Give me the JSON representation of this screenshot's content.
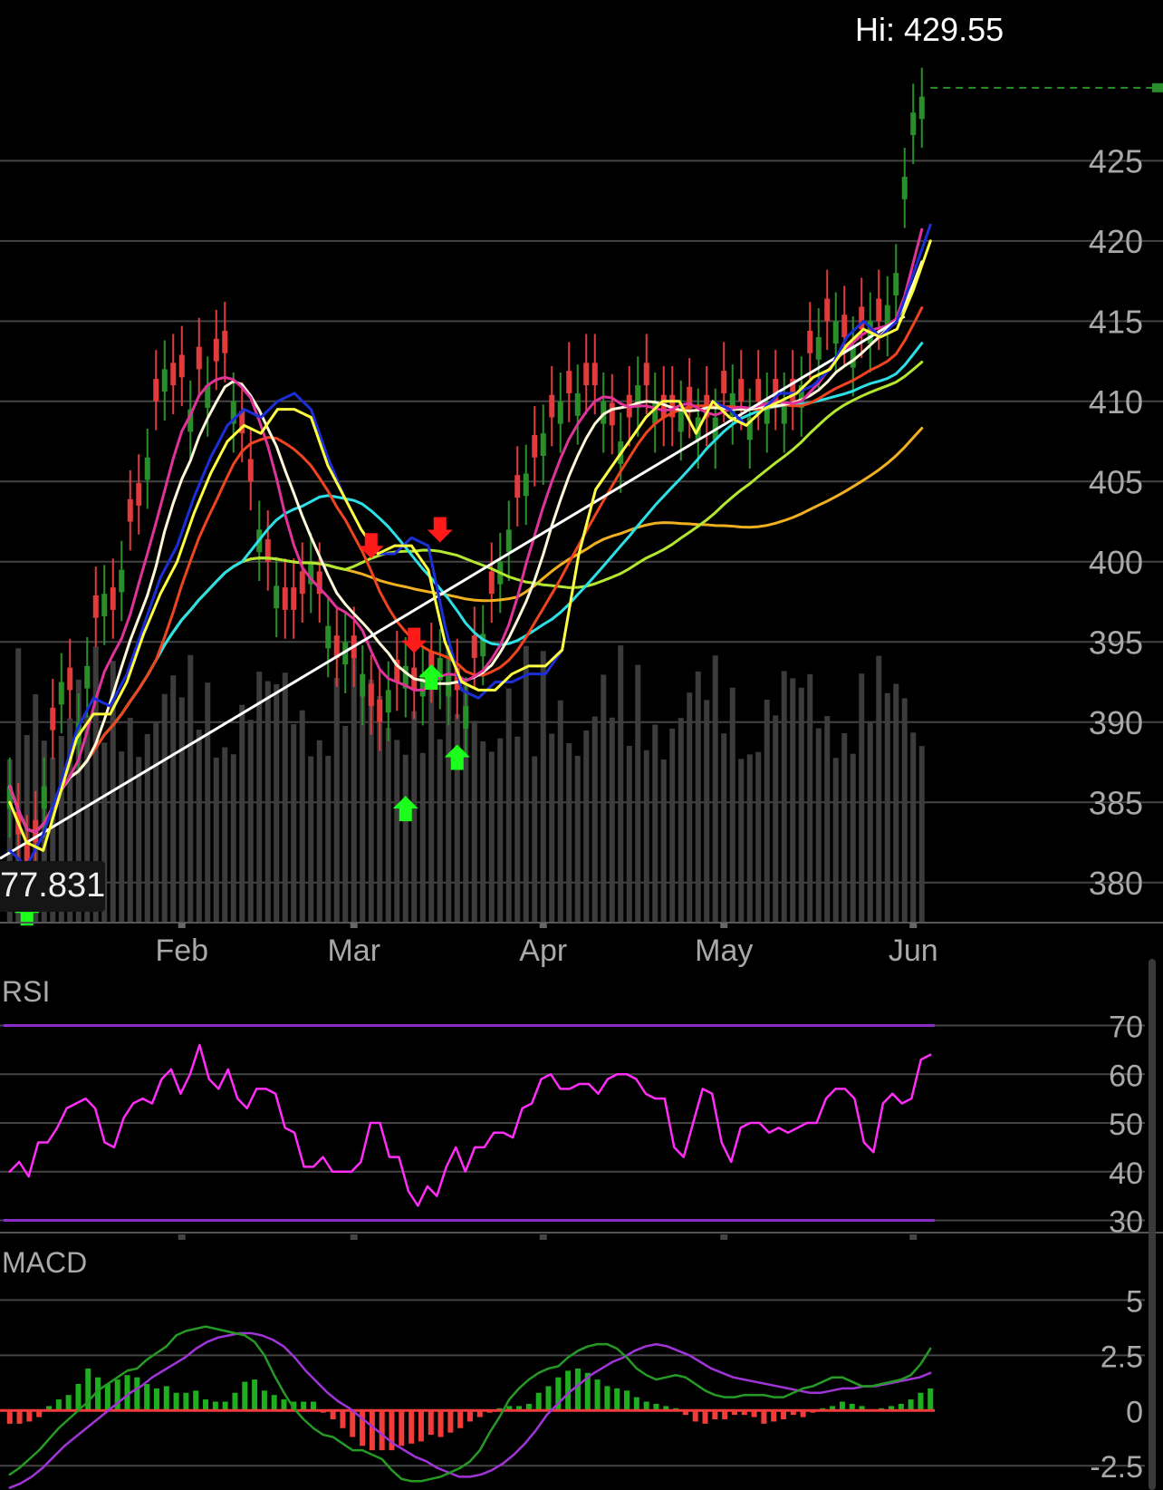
{
  "header": {
    "hi_prefix": "Hi:",
    "hi_value": "429.55",
    "low_value": "77.831"
  },
  "colors": {
    "up_candle": "#2a8f2a",
    "down_candle": "#e23b3b",
    "volume": "#3c3c3c",
    "grid": "#444444",
    "axis_text": "#a8a8a8",
    "ma_blue": "#1b2fd8",
    "ma_yellow": "#ffff40",
    "ma_magenta": "#e0339a",
    "ma_cream": "#fff8d8",
    "ma_orange": "#f0441e",
    "trend_white": "#ffffff",
    "ma_cyan": "#2ce0e8",
    "ma_lime": "#b4e830",
    "ma_gold": "#f0b020",
    "rsi": "#ff2df6",
    "rsi_bands": "#8a2bc8",
    "macd": "#259a25",
    "macd_signal": "#9f35d6",
    "hist_up": "#1fae1f",
    "hist_down": "#f23b3b",
    "buy_arrow": "#1cff1c",
    "sell_arrow": "#ff1a1a"
  },
  "chart_data": [
    {
      "type": "candlestick",
      "title": "",
      "x_labels": [
        "Feb",
        "Mar",
        "Apr",
        "May",
        "Jun"
      ],
      "x_label_days": [
        20,
        40,
        62,
        83,
        105
      ],
      "y_ticks": [
        425,
        420,
        415,
        410,
        405,
        400,
        395,
        390,
        385,
        380
      ],
      "ylim": [
        377.5,
        430.5
      ],
      "hi_value": 429.55,
      "day_count": 108,
      "close": [
        386,
        383,
        381,
        382.5,
        386,
        389.5,
        392.5,
        392,
        390,
        393.5,
        396.5,
        398,
        397,
        399.5,
        402.5,
        403.5,
        406.5,
        410,
        412,
        411,
        411.5,
        409.5,
        412,
        411,
        412.5,
        413,
        410,
        408,
        405,
        402,
        400,
        398.5,
        397,
        397,
        398,
        400,
        398,
        396,
        394,
        395,
        394,
        393,
        391,
        390,
        392,
        392.5,
        393.5,
        392,
        393,
        393,
        394,
        393,
        392,
        391,
        394,
        395.5,
        398,
        400,
        402,
        404,
        405.5,
        406.5,
        408,
        409,
        410,
        410.5,
        410.5,
        411,
        411,
        410,
        408.5,
        407.5,
        409,
        411,
        411,
        410,
        409,
        409,
        409.5,
        409.5,
        409,
        409,
        409,
        410.5,
        410.5,
        410,
        409,
        410,
        410,
        410,
        410,
        410,
        411,
        413,
        414,
        415,
        415,
        414,
        413.5,
        414.5,
        415,
        415,
        416,
        418,
        424,
        428,
        429
      ],
      "bull_days": [
        0,
        4,
        6,
        8,
        9,
        11,
        13,
        16,
        18,
        21,
        23,
        26,
        29,
        31,
        35,
        37,
        39,
        41,
        44,
        46,
        48,
        50,
        51,
        53,
        55,
        57,
        58,
        60,
        62,
        64,
        66,
        69,
        71,
        73,
        75,
        78,
        80,
        82,
        84,
        86,
        88,
        90,
        92,
        94,
        96,
        98,
        100,
        102,
        103,
        104,
        105,
        106,
        107
      ],
      "moving_averages": [
        {
          "color_key": "ma_blue",
          "values": [
            382,
            381,
            383,
            386,
            389.5,
            391.5,
            391,
            393,
            396,
            399,
            401,
            404,
            406.5,
            408.5,
            409.5,
            409,
            410,
            410.5,
            409.5,
            406.5,
            404,
            402,
            400.5,
            400.5,
            401.5,
            401,
            396,
            392,
            391.5,
            392.5,
            392.5,
            393,
            393,
            394.5,
            400.5,
            404.5,
            406,
            407.5,
            409,
            410,
            410,
            408,
            410,
            409.5,
            408.5,
            409.5,
            410.5,
            410.5,
            411,
            412,
            414,
            415,
            414,
            415,
            418,
            421
          ]
        },
        {
          "color_key": "ma_yellow",
          "values": [
            385,
            382.5,
            382,
            385.5,
            389,
            390.5,
            390.5,
            392.5,
            395.5,
            398,
            400,
            403,
            405.5,
            407.5,
            408.5,
            408,
            409.5,
            409.5,
            409,
            406,
            404,
            402,
            400.5,
            401,
            401,
            399.5,
            395,
            392.5,
            392,
            392,
            393,
            393.5,
            393.5,
            394.5,
            400.5,
            404.5,
            406,
            407.5,
            409,
            410,
            410,
            408,
            410,
            409,
            408.5,
            409.5,
            410,
            410.5,
            411.5,
            412,
            413.5,
            414.5,
            414,
            414.5,
            417,
            420
          ]
        }
      ]
    },
    {
      "type": "line",
      "title": "RSI",
      "y_ticks": [
        70,
        60,
        50,
        40,
        30
      ],
      "ylim": [
        26,
        74
      ],
      "overbought": 70,
      "oversold": 30,
      "values": [
        40,
        42,
        39,
        46,
        46,
        49,
        53,
        54,
        55,
        53,
        46,
        45,
        51,
        54,
        55,
        54,
        59,
        61,
        56,
        60,
        66,
        59,
        57,
        61,
        55,
        53,
        57,
        57,
        56,
        49,
        48,
        41,
        41,
        43,
        40,
        40,
        40,
        42,
        50,
        50,
        43,
        43,
        36,
        33,
        37,
        35,
        41,
        45,
        40,
        45,
        45,
        48,
        48,
        47,
        53,
        54,
        59,
        60,
        57,
        57,
        58,
        58,
        56,
        59,
        60,
        60,
        59,
        56,
        55,
        55,
        45,
        43,
        50,
        57,
        56,
        46,
        42,
        49,
        50,
        50,
        48,
        49,
        48,
        49,
        50,
        50,
        55,
        57,
        57,
        55,
        46,
        44,
        54,
        56,
        54,
        55,
        63,
        64
      ]
    },
    {
      "type": "line",
      "title": "MACD",
      "y_ticks": [
        "5",
        "2.5",
        "0",
        "-2.5"
      ],
      "ylim": [
        -3.6,
        6
      ],
      "macd": [
        -2.9,
        -2.6,
        -2.2,
        -1.8,
        -1.3,
        -0.8,
        -0.4,
        0.0,
        0.4,
        0.9,
        1.2,
        1.5,
        1.8,
        1.9,
        2.3,
        2.6,
        2.9,
        3.4,
        3.6,
        3.7,
        3.8,
        3.7,
        3.6,
        3.5,
        3.4,
        3.1,
        2.5,
        1.6,
        0.8,
        0.1,
        -0.4,
        -0.8,
        -1.1,
        -1.2,
        -1.5,
        -1.8,
        -1.8,
        -2.0,
        -2.2,
        -2.7,
        -3.1,
        -3.2,
        -3.2,
        -3.1,
        -3.0,
        -2.8,
        -2.6,
        -2.3,
        -1.8,
        -1.0,
        -0.3,
        0.5,
        1.0,
        1.4,
        1.7,
        1.9,
        2.0,
        2.4,
        2.7,
        2.9,
        3.0,
        3.0,
        2.8,
        2.4,
        1.9,
        1.6,
        1.4,
        1.5,
        1.6,
        1.5,
        1.2,
        0.9,
        0.7,
        0.6,
        0.6,
        0.7,
        0.7,
        0.7,
        0.6,
        0.6,
        0.8,
        1.0,
        1.1,
        1.3,
        1.5,
        1.5,
        1.3,
        1.1,
        1.1,
        1.2,
        1.3,
        1.4,
        1.6,
        2.1,
        2.8
      ],
      "signal": [
        -3.5,
        -3.3,
        -3.0,
        -2.6,
        -2.1,
        -1.6,
        -1.2,
        -0.8,
        -0.4,
        0.0,
        0.4,
        0.8,
        1.1,
        1.5,
        1.8,
        2.1,
        2.4,
        2.8,
        3.1,
        3.3,
        3.4,
        3.5,
        3.5,
        3.4,
        3.2,
        2.9,
        2.4,
        1.8,
        1.3,
        0.8,
        0.4,
        0.1,
        -0.3,
        -0.7,
        -1.1,
        -1.5,
        -1.8,
        -2.1,
        -2.3,
        -2.6,
        -2.8,
        -3.0,
        -3.0,
        -2.9,
        -2.7,
        -2.4,
        -2.0,
        -1.5,
        -0.9,
        -0.2,
        0.3,
        0.8,
        1.2,
        1.6,
        1.9,
        2.2,
        2.4,
        2.7,
        2.9,
        3.0,
        2.9,
        2.7,
        2.5,
        2.2,
        1.9,
        1.7,
        1.5,
        1.4,
        1.3,
        1.2,
        1.1,
        1.0,
        0.9,
        0.8,
        0.8,
        0.9,
        1.0,
        1.0,
        1.1,
        1.1,
        1.2,
        1.3,
        1.4,
        1.5,
        1.7
      ],
      "histogram": [
        -0.6,
        -0.6,
        -0.5,
        -0.3,
        0.2,
        0.5,
        0.7,
        1.2,
        1.9,
        1.5,
        1.2,
        1.4,
        1.6,
        1.5,
        1.2,
        1.0,
        1.1,
        0.8,
        0.8,
        0.9,
        0.5,
        0.4,
        0.4,
        0.8,
        1.3,
        1.4,
        0.9,
        0.7,
        0.5,
        0.4,
        0.4,
        0.4,
        -0.1,
        -0.4,
        -0.8,
        -1.2,
        -1.6,
        -1.8,
        -1.8,
        -1.8,
        -1.6,
        -1.5,
        -1.4,
        -1.1,
        -1.2,
        -1.0,
        -0.8,
        -0.5,
        -0.3,
        -0.1,
        0.1,
        0.2,
        0.2,
        0.3,
        0.8,
        1.1,
        1.5,
        1.8,
        1.9,
        1.7,
        1.4,
        1.1,
        1.0,
        0.9,
        0.6,
        0.4,
        0.3,
        0.2,
        0.1,
        -0.2,
        -0.5,
        -0.6,
        -0.4,
        -0.4,
        -0.2,
        -0.2,
        -0.3,
        -0.6,
        -0.5,
        -0.4,
        -0.2,
        -0.3,
        -0.1,
        0.1,
        0.2,
        0.4,
        0.3,
        0.2,
        0.0,
        0.1,
        0.2,
        0.3,
        0.5,
        0.8,
        1.0
      ]
    }
  ]
}
